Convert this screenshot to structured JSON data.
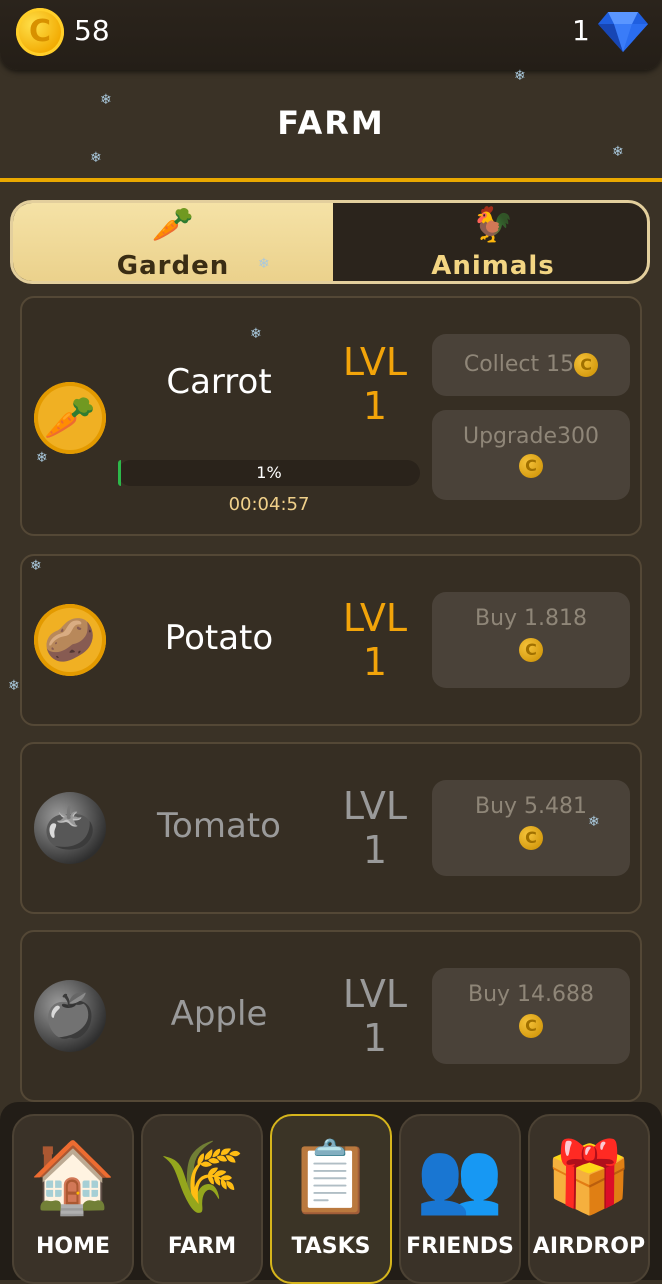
{
  "header": {
    "coins": "58",
    "gems": "1",
    "coin_symbol": "C",
    "gem_icon": "diamond-icon"
  },
  "page": {
    "title": "FARM"
  },
  "tabs": [
    {
      "label": "Garden",
      "emoji": "🥕",
      "selected": true
    },
    {
      "label": "Animals",
      "emoji": "🐓",
      "selected": false
    }
  ],
  "crops": [
    {
      "name": "Carrot",
      "emoji": "🥕",
      "lvl_label": "LVL",
      "lvl": "1",
      "collect": "Collect 15",
      "upgrade": "Upgrade300",
      "progress": "1%",
      "timer": "00:04:57"
    },
    {
      "name": "Potato",
      "emoji": "🥔",
      "lvl_label": "LVL",
      "lvl": "1",
      "buy": "Buy 1.818"
    },
    {
      "name": "Tomato",
      "emoji": "🍅",
      "lvl_label": "LVL",
      "lvl": "1",
      "buy": "Buy 5.481"
    },
    {
      "name": "Apple",
      "emoji": "🍎",
      "lvl_label": "LVL",
      "lvl": "1",
      "buy": "Buy 14.688"
    }
  ],
  "nav": [
    {
      "label": "HOME",
      "emoji": "🏠"
    },
    {
      "label": "FARM",
      "emoji": "🌾"
    },
    {
      "label": "TASKS",
      "emoji": "📋",
      "active": true
    },
    {
      "label": "FRIENDS",
      "emoji": "👥"
    },
    {
      "label": "AIRDROP",
      "emoji": "🎁"
    }
  ],
  "colors": {
    "accent": "#e9a800",
    "gold_text": "#f2a40a",
    "bg": "#3a3226"
  }
}
